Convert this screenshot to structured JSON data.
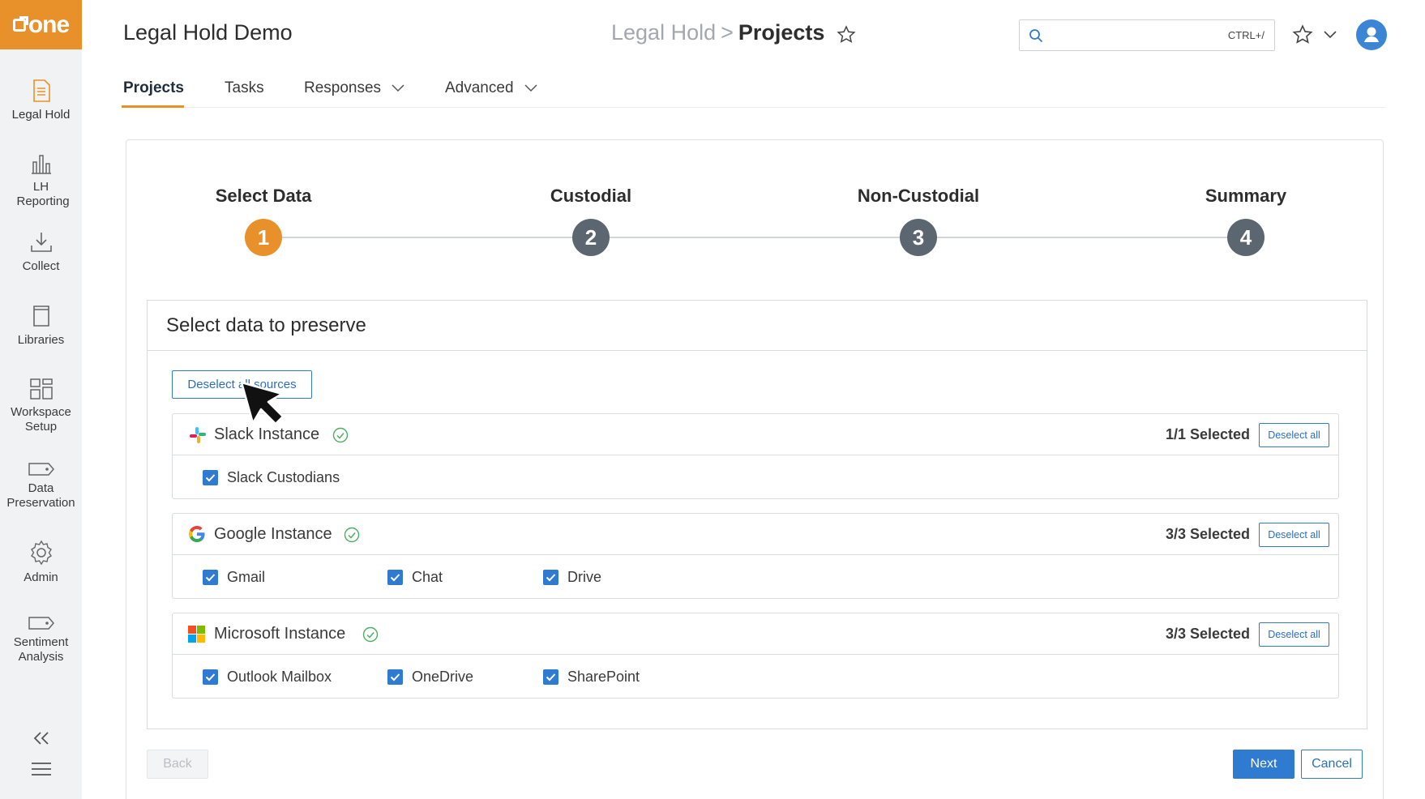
{
  "app": {
    "logo_text": "one",
    "title": "Legal Hold Demo",
    "brand_color": "#e8912a",
    "accent_color": "#2f7bd1"
  },
  "breadcrumb": {
    "parent": "Legal Hold",
    "separator": ">",
    "current": "Projects"
  },
  "search": {
    "value": "",
    "placeholder": "",
    "shortcut": "CTRL+/"
  },
  "sidebar": {
    "items": [
      {
        "label": "Legal Hold",
        "icon": "document-icon"
      },
      {
        "label": "LH Reporting",
        "icon": "bar-chart-icon"
      },
      {
        "label": "Collect",
        "icon": "download-tray-icon"
      },
      {
        "label": "Libraries",
        "icon": "book-icon"
      },
      {
        "label": "Workspace Setup",
        "icon": "grid-layout-icon"
      },
      {
        "label": "Data Preservation",
        "icon": "tag-icon"
      },
      {
        "label": "Admin",
        "icon": "gear-icon"
      },
      {
        "label": "Sentiment Analysis",
        "icon": "tag-icon"
      }
    ]
  },
  "tabs": [
    {
      "label": "Projects",
      "active": true
    },
    {
      "label": "Tasks"
    },
    {
      "label": "Responses",
      "dropdown": true
    },
    {
      "label": "Advanced",
      "dropdown": true
    }
  ],
  "stepper": {
    "steps": [
      {
        "number": "1",
        "label": "Select Data",
        "state": "active"
      },
      {
        "number": "2",
        "label": "Custodial",
        "state": "todo"
      },
      {
        "number": "3",
        "label": "Non-Custodial",
        "state": "todo"
      },
      {
        "number": "4",
        "label": "Summary",
        "state": "todo"
      }
    ]
  },
  "panel": {
    "title": "Select data to preserve",
    "deselect_sources_label": "Deselect all sources",
    "sources": [
      {
        "name": "Slack Instance",
        "count": "1/1 Selected",
        "deselect_label": "Deselect all",
        "options": [
          {
            "label": "Slack Custodians",
            "checked": true
          }
        ]
      },
      {
        "name": "Google Instance",
        "count": "3/3 Selected",
        "deselect_label": "Deselect all",
        "options": [
          {
            "label": "Gmail",
            "checked": true
          },
          {
            "label": "Chat",
            "checked": true
          },
          {
            "label": "Drive",
            "checked": true
          }
        ]
      },
      {
        "name": "Microsoft Instance",
        "count": "3/3 Selected",
        "deselect_label": "Deselect all",
        "options": [
          {
            "label": "Outlook Mailbox",
            "checked": true
          },
          {
            "label": "OneDrive",
            "checked": true
          },
          {
            "label": "SharePoint",
            "checked": true
          }
        ]
      }
    ]
  },
  "footer": {
    "back_label": "Back",
    "next_label": "Next",
    "cancel_label": "Cancel"
  }
}
